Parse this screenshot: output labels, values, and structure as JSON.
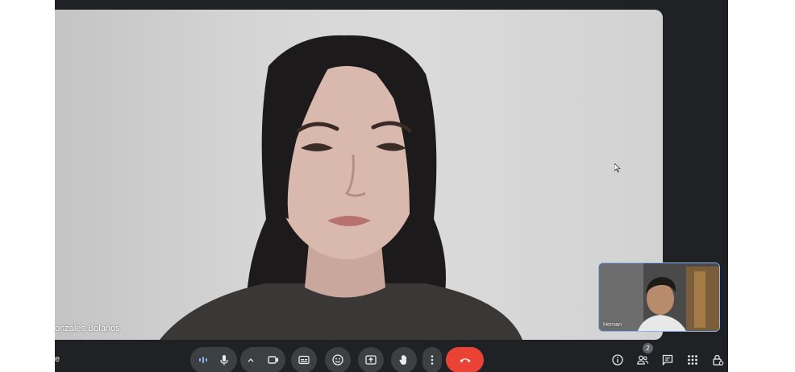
{
  "participants": {
    "main_name": "onzales Bolaños",
    "self_name": "Hernan"
  },
  "toolbar": {
    "left_fragment": "e",
    "people_count": "2"
  },
  "icons": [
    "audio-level-icon",
    "microphone-icon",
    "chevron-up-icon",
    "camera-icon",
    "captions-icon",
    "emoji-icon",
    "present-screen-icon",
    "raise-hand-icon",
    "more-options-icon",
    "end-call-icon",
    "info-icon",
    "people-icon",
    "chat-icon",
    "activities-icon",
    "host-controls-icon"
  ],
  "colors": {
    "background": "#202124",
    "control": "#3c4043",
    "end_call": "#ea4335",
    "self_border": "#8ab4f8"
  }
}
